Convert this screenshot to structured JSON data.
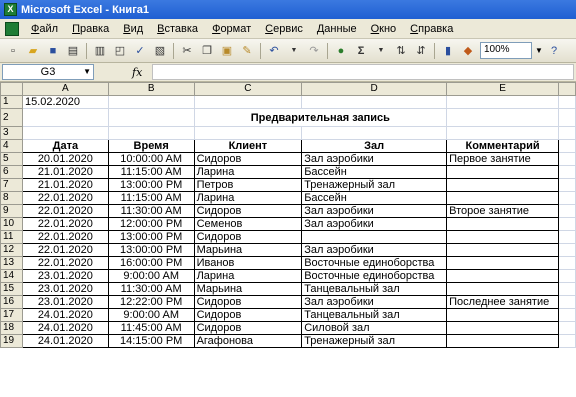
{
  "window": {
    "title": "Microsoft Excel - Книга1"
  },
  "menu": [
    "Файл",
    "Правка",
    "Вид",
    "Вставка",
    "Формат",
    "Сервис",
    "Данные",
    "Окно",
    "Справка"
  ],
  "toolbar": {
    "zoom": "100%",
    "sigma": "Σ"
  },
  "formula_bar": {
    "cell_ref": "G3",
    "fx": "fx",
    "content": ""
  },
  "columns": [
    "A",
    "B",
    "C",
    "D",
    "E"
  ],
  "sheet": {
    "row1": {
      "num": "1",
      "a": "15.02.2020"
    },
    "row2": {
      "num": "2",
      "title": "Предварительная запись"
    },
    "row3": {
      "num": "3"
    },
    "headers": {
      "num": "4",
      "date": "Дата",
      "time": "Время",
      "client": "Клиент",
      "hall": "Зал",
      "comment": "Комментарий"
    },
    "records": [
      {
        "num": "5",
        "date": "20.01.2020",
        "time": "10:00:00 AM",
        "client": "Сидоров",
        "hall": "Зал аэробики",
        "comment": "Первое занятие"
      },
      {
        "num": "6",
        "date": "21.01.2020",
        "time": "11:15:00 AM",
        "client": "Ларина",
        "hall": "Бассейн",
        "comment": ""
      },
      {
        "num": "7",
        "date": "21.01.2020",
        "time": "13:00:00 PM",
        "client": "Петров",
        "hall": "Тренажерный зал",
        "comment": ""
      },
      {
        "num": "8",
        "date": "22.01.2020",
        "time": "11:15:00 AM",
        "client": "Ларина",
        "hall": "Бассейн",
        "comment": ""
      },
      {
        "num": "9",
        "date": "22.01.2020",
        "time": "11:30:00 AM",
        "client": "Сидоров",
        "hall": "Зал аэробики",
        "comment": "Второе занятие"
      },
      {
        "num": "10",
        "date": "22.01.2020",
        "time": "12:00:00 PM",
        "client": "Семенов",
        "hall": "Зал аэробики",
        "comment": ""
      },
      {
        "num": "11",
        "date": "22.01.2020",
        "time": "13:00:00 PM",
        "client": "Сидоров",
        "hall": "",
        "comment": ""
      },
      {
        "num": "12",
        "date": "22.01.2020",
        "time": "13:00:00 PM",
        "client": "Марьина",
        "hall": "Зал аэробики",
        "comment": ""
      },
      {
        "num": "13",
        "date": "22.01.2020",
        "time": "16:00:00 PM",
        "client": "Иванов",
        "hall": "Восточные единоборства",
        "comment": ""
      },
      {
        "num": "14",
        "date": "23.01.2020",
        "time": "9:00:00 AM",
        "client": "Ларина",
        "hall": "Восточные единоборства",
        "comment": ""
      },
      {
        "num": "15",
        "date": "23.01.2020",
        "time": "11:30:00 AM",
        "client": "Марьина",
        "hall": "Танцевальный зал",
        "comment": ""
      },
      {
        "num": "16",
        "date": "23.01.2020",
        "time": "12:22:00 PM",
        "client": "Сидоров",
        "hall": "Зал аэробики",
        "comment": "Последнее занятие"
      },
      {
        "num": "17",
        "date": "24.01.2020",
        "time": "9:00:00 AM",
        "client": "Сидоров",
        "hall": "Танцевальный зал",
        "comment": ""
      },
      {
        "num": "18",
        "date": "24.01.2020",
        "time": "11:45:00 AM",
        "client": "Сидоров",
        "hall": "Силовой зал",
        "comment": ""
      },
      {
        "num": "19",
        "date": "24.01.2020",
        "time": "14:15:00 PM",
        "client": "Агафонова",
        "hall": "Тренажерный зал",
        "comment": ""
      }
    ]
  }
}
